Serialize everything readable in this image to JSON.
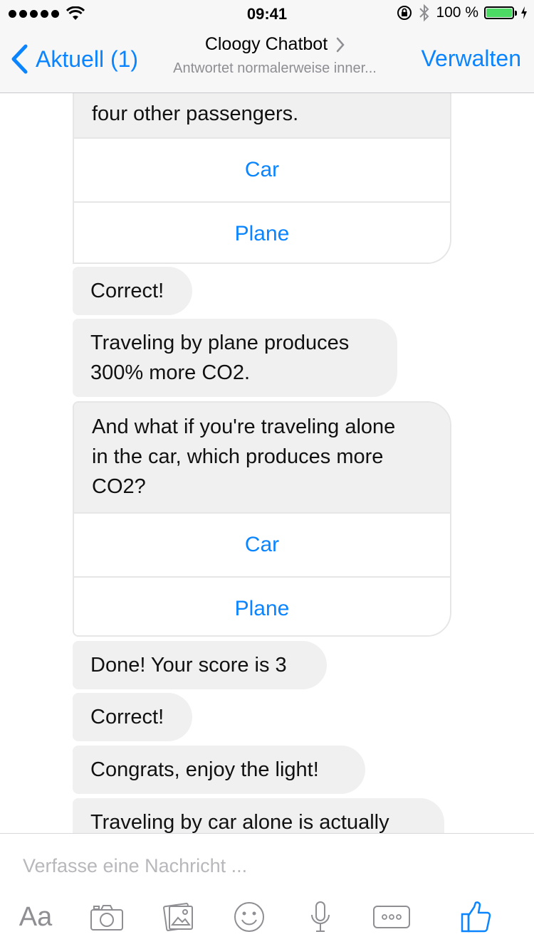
{
  "status_bar": {
    "time": "09:41",
    "battery": "100 %"
  },
  "nav": {
    "back_label": "Aktuell (1)",
    "title": "Cloogy Chatbot",
    "subtitle": "Antwortet normalerweise inner...",
    "action": "Verwalten"
  },
  "chat": {
    "card1": {
      "text": "four other passengers.",
      "buttons": [
        "Car",
        "Plane"
      ]
    },
    "messages1": [
      "Correct!",
      "Traveling by plane produces",
      "300% more CO2."
    ],
    "card2": {
      "lines": [
        "And what if you're traveling alone",
        "in the car, which produces more",
        "CO2?"
      ],
      "buttons": [
        "Car",
        "Plane"
      ]
    },
    "messages2": [
      "Done! Your score is 3",
      "Correct!",
      "Congrats, enjoy the light!",
      "Traveling by car alone is actually"
    ]
  },
  "composer": {
    "placeholder": "Verfasse eine Nachricht ...",
    "aa_label": "Aa"
  },
  "colors": {
    "accent": "#0a84ff",
    "bubble": "#f0f0f0",
    "battery": "#4cd964"
  },
  "icons": [
    "wifi-icon",
    "rotation-lock-icon",
    "bluetooth-icon",
    "battery-icon",
    "back-chevron-icon",
    "chevron-right-icon",
    "camera-icon",
    "gallery-icon",
    "emoji-icon",
    "microphone-icon",
    "more-icon",
    "thumbs-up-icon"
  ]
}
